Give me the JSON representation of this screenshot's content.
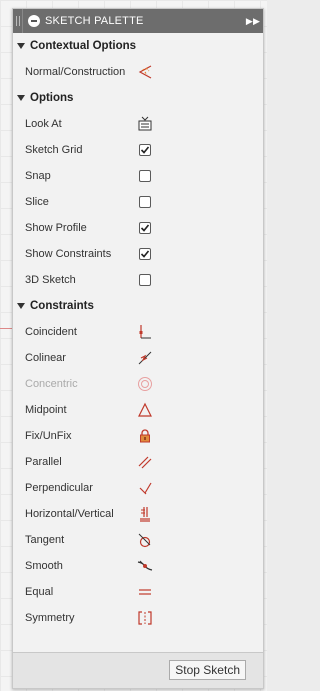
{
  "palette": {
    "title": "SKETCH PALETTE",
    "expand_glyph": "▶▶"
  },
  "sections": {
    "contextual": {
      "title": "Contextual Options",
      "items": [
        {
          "label": "Normal/Construction",
          "icon": "normal-construction-icon"
        }
      ]
    },
    "options": {
      "title": "Options",
      "items": [
        {
          "label": "Look At",
          "control": "button",
          "icon": "look-at-icon"
        },
        {
          "label": "Sketch Grid",
          "control": "checkbox",
          "checked": true
        },
        {
          "label": "Snap",
          "control": "checkbox",
          "checked": false
        },
        {
          "label": "Slice",
          "control": "checkbox",
          "checked": false
        },
        {
          "label": "Show Profile",
          "control": "checkbox",
          "checked": true
        },
        {
          "label": "Show Constraints",
          "control": "checkbox",
          "checked": true
        },
        {
          "label": "3D Sketch",
          "control": "checkbox",
          "checked": false
        }
      ]
    },
    "constraints": {
      "title": "Constraints",
      "items": [
        {
          "label": "Coincident",
          "icon": "coincident-icon"
        },
        {
          "label": "Colinear",
          "icon": "colinear-icon"
        },
        {
          "label": "Concentric",
          "icon": "concentric-icon",
          "disabled": true
        },
        {
          "label": "Midpoint",
          "icon": "midpoint-icon"
        },
        {
          "label": "Fix/UnFix",
          "icon": "lock-icon"
        },
        {
          "label": "Parallel",
          "icon": "parallel-icon"
        },
        {
          "label": "Perpendicular",
          "icon": "perpendicular-icon"
        },
        {
          "label": "Horizontal/Vertical",
          "icon": "horizontal-vertical-icon"
        },
        {
          "label": "Tangent",
          "icon": "tangent-icon"
        },
        {
          "label": "Smooth",
          "icon": "smooth-icon"
        },
        {
          "label": "Equal",
          "icon": "equal-icon"
        },
        {
          "label": "Symmetry",
          "icon": "symmetry-icon"
        }
      ]
    }
  },
  "footer": {
    "stop_label": "Stop Sketch"
  },
  "colors": {
    "accent_red": "#c0392b",
    "disabled": "#aaaaaa",
    "titlebar": "#6d6d6d"
  }
}
